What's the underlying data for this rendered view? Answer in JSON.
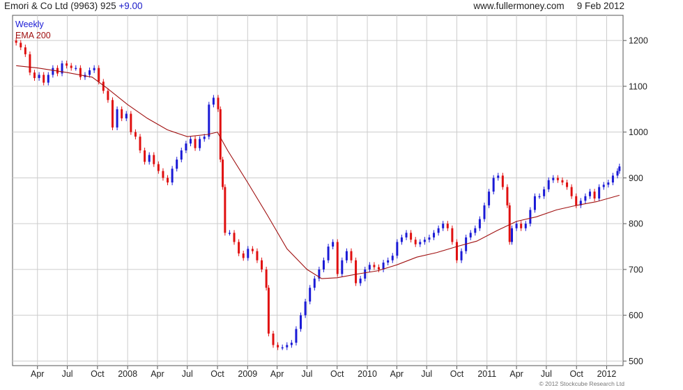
{
  "header": {
    "symbol": "Emori & Co Ltd (9963) 925",
    "change": "+9.00",
    "site": "www.fullermoney.com",
    "date": "9 Feb 2012"
  },
  "copyright": "© 2012 Stockcube Research Ltd",
  "colors": {
    "up_bar": "#1a1ad6",
    "down_bar": "#e01010",
    "ema_line": "#a01010",
    "grid": "#cccccc",
    "axis": "#555555"
  },
  "chart_data": {
    "type": "candlestick",
    "legend": [
      "Weekly",
      "EMA 200"
    ],
    "legend_colors": [
      "#1a1ad6",
      "#a01010"
    ],
    "ylim": [
      490,
      1255
    ],
    "y_ticks": [
      500,
      600,
      700,
      800,
      900,
      1000,
      1100,
      1200
    ],
    "x_ticks": [
      "Apr",
      "Jul",
      "Oct",
      "2008",
      "Apr",
      "Jul",
      "Oct",
      "2009",
      "Apr",
      "Jul",
      "Oct",
      "2010",
      "Apr",
      "Jul",
      "Oct",
      "2011",
      "Apr",
      "Jul",
      "Oct",
      "2012"
    ],
    "x_tick_dates": [
      "2007-04",
      "2007-07",
      "2007-10",
      "2008-01",
      "2008-04",
      "2008-07",
      "2008-10",
      "2009-01",
      "2009-04",
      "2009-07",
      "2009-10",
      "2010-01",
      "2010-04",
      "2010-07",
      "2010-10",
      "2011-01",
      "2011-04",
      "2011-07",
      "2011-10",
      "2012-01"
    ],
    "grid": true,
    "legend_position": "top-left",
    "close_series": [
      [
        "2007-01-26",
        1195
      ],
      [
        "2007-02-09",
        1185
      ],
      [
        "2007-02-23",
        1170
      ],
      [
        "2007-03-09",
        1130
      ],
      [
        "2007-03-23",
        1118
      ],
      [
        "2007-04-06",
        1125
      ],
      [
        "2007-04-20",
        1108
      ],
      [
        "2007-05-04",
        1125
      ],
      [
        "2007-05-18",
        1140
      ],
      [
        "2007-06-01",
        1128
      ],
      [
        "2007-06-15",
        1150
      ],
      [
        "2007-06-29",
        1145
      ],
      [
        "2007-07-13",
        1140
      ],
      [
        "2007-07-27",
        1140
      ],
      [
        "2007-08-10",
        1120
      ],
      [
        "2007-08-24",
        1125
      ],
      [
        "2007-09-07",
        1135
      ],
      [
        "2007-09-21",
        1140
      ],
      [
        "2007-10-05",
        1110
      ],
      [
        "2007-10-19",
        1090
      ],
      [
        "2007-11-02",
        1070
      ],
      [
        "2007-11-16",
        1010
      ],
      [
        "2007-11-30",
        1050
      ],
      [
        "2007-12-14",
        1030
      ],
      [
        "2007-12-28",
        1040
      ],
      [
        "2008-01-11",
        1000
      ],
      [
        "2008-01-25",
        990
      ],
      [
        "2008-02-08",
        960
      ],
      [
        "2008-02-22",
        935
      ],
      [
        "2008-03-07",
        950
      ],
      [
        "2008-03-21",
        930
      ],
      [
        "2008-04-04",
        915
      ],
      [
        "2008-04-18",
        900
      ],
      [
        "2008-05-02",
        890
      ],
      [
        "2008-05-16",
        920
      ],
      [
        "2008-05-30",
        940
      ],
      [
        "2008-06-13",
        960
      ],
      [
        "2008-06-27",
        975
      ],
      [
        "2008-07-11",
        985
      ],
      [
        "2008-07-25",
        965
      ],
      [
        "2008-08-08",
        985
      ],
      [
        "2008-08-22",
        990
      ],
      [
        "2008-09-05",
        1060
      ],
      [
        "2008-09-19",
        1075
      ],
      [
        "2008-10-03",
        1050
      ],
      [
        "2008-10-10",
        940
      ],
      [
        "2008-10-17",
        880
      ],
      [
        "2008-10-24",
        780
      ],
      [
        "2008-11-07",
        780
      ],
      [
        "2008-11-21",
        760
      ],
      [
        "2008-12-05",
        735
      ],
      [
        "2008-12-19",
        725
      ],
      [
        "2009-01-02",
        745
      ],
      [
        "2009-01-16",
        740
      ],
      [
        "2009-01-30",
        720
      ],
      [
        "2009-02-13",
        700
      ],
      [
        "2009-02-27",
        660
      ],
      [
        "2009-03-06",
        560
      ],
      [
        "2009-03-20",
        535
      ],
      [
        "2009-04-03",
        530
      ],
      [
        "2009-04-17",
        530
      ],
      [
        "2009-05-01",
        535
      ],
      [
        "2009-05-15",
        540
      ],
      [
        "2009-05-29",
        570
      ],
      [
        "2009-06-12",
        600
      ],
      [
        "2009-06-26",
        630
      ],
      [
        "2009-07-10",
        660
      ],
      [
        "2009-07-24",
        680
      ],
      [
        "2009-08-07",
        700
      ],
      [
        "2009-08-21",
        720
      ],
      [
        "2009-09-04",
        750
      ],
      [
        "2009-09-18",
        760
      ],
      [
        "2009-10-02",
        690
      ],
      [
        "2009-10-16",
        720
      ],
      [
        "2009-10-30",
        740
      ],
      [
        "2009-11-13",
        720
      ],
      [
        "2009-11-27",
        670
      ],
      [
        "2009-12-11",
        680
      ],
      [
        "2009-12-25",
        700
      ],
      [
        "2010-01-08",
        710
      ],
      [
        "2010-01-22",
        705
      ],
      [
        "2010-02-05",
        700
      ],
      [
        "2010-02-19",
        715
      ],
      [
        "2010-03-05",
        720
      ],
      [
        "2010-03-19",
        730
      ],
      [
        "2010-04-02",
        760
      ],
      [
        "2010-04-16",
        770
      ],
      [
        "2010-04-30",
        780
      ],
      [
        "2010-05-14",
        765
      ],
      [
        "2010-05-28",
        755
      ],
      [
        "2010-06-11",
        760
      ],
      [
        "2010-06-25",
        765
      ],
      [
        "2010-07-09",
        770
      ],
      [
        "2010-07-23",
        780
      ],
      [
        "2010-08-06",
        790
      ],
      [
        "2010-08-20",
        800
      ],
      [
        "2010-09-03",
        790
      ],
      [
        "2010-09-17",
        760
      ],
      [
        "2010-10-01",
        720
      ],
      [
        "2010-10-15",
        740
      ],
      [
        "2010-10-29",
        770
      ],
      [
        "2010-11-12",
        780
      ],
      [
        "2010-11-26",
        790
      ],
      [
        "2010-12-10",
        810
      ],
      [
        "2010-12-24",
        840
      ],
      [
        "2011-01-07",
        870
      ],
      [
        "2011-01-21",
        900
      ],
      [
        "2011-02-04",
        905
      ],
      [
        "2011-02-18",
        880
      ],
      [
        "2011-03-04",
        840
      ],
      [
        "2011-03-11",
        760
      ],
      [
        "2011-03-18",
        790
      ],
      [
        "2011-04-01",
        800
      ],
      [
        "2011-04-15",
        790
      ],
      [
        "2011-04-29",
        800
      ],
      [
        "2011-05-13",
        830
      ],
      [
        "2011-05-27",
        860
      ],
      [
        "2011-06-10",
        860
      ],
      [
        "2011-06-24",
        875
      ],
      [
        "2011-07-08",
        895
      ],
      [
        "2011-07-22",
        900
      ],
      [
        "2011-08-05",
        895
      ],
      [
        "2011-08-19",
        890
      ],
      [
        "2011-09-02",
        880
      ],
      [
        "2011-09-16",
        860
      ],
      [
        "2011-09-30",
        840
      ],
      [
        "2011-10-14",
        850
      ],
      [
        "2011-10-28",
        860
      ],
      [
        "2011-11-11",
        870
      ],
      [
        "2011-11-25",
        855
      ],
      [
        "2011-12-09",
        880
      ],
      [
        "2011-12-23",
        885
      ],
      [
        "2012-01-06",
        890
      ],
      [
        "2012-01-20",
        905
      ],
      [
        "2012-02-03",
        915
      ],
      [
        "2012-02-09",
        925
      ]
    ],
    "ema_200": [
      [
        "2007-01-26",
        1145
      ],
      [
        "2007-04-01",
        1140
      ],
      [
        "2007-07-01",
        1130
      ],
      [
        "2007-09-15",
        1120
      ],
      [
        "2007-11-01",
        1095
      ],
      [
        "2008-01-01",
        1060
      ],
      [
        "2008-03-01",
        1030
      ],
      [
        "2008-05-01",
        1005
      ],
      [
        "2008-07-01",
        990
      ],
      [
        "2008-09-01",
        995
      ],
      [
        "2008-10-01",
        1000
      ],
      [
        "2008-11-01",
        960
      ],
      [
        "2009-01-01",
        890
      ],
      [
        "2009-03-01",
        820
      ],
      [
        "2009-05-01",
        745
      ],
      [
        "2009-07-01",
        700
      ],
      [
        "2009-08-15",
        680
      ],
      [
        "2009-10-01",
        682
      ],
      [
        "2009-12-01",
        690
      ],
      [
        "2010-02-01",
        697
      ],
      [
        "2010-04-01",
        710
      ],
      [
        "2010-06-01",
        727
      ],
      [
        "2010-08-01",
        737
      ],
      [
        "2010-10-01",
        750
      ],
      [
        "2010-12-01",
        762
      ],
      [
        "2011-02-01",
        785
      ],
      [
        "2011-04-01",
        805
      ],
      [
        "2011-06-01",
        815
      ],
      [
        "2011-08-01",
        830
      ],
      [
        "2011-10-01",
        840
      ],
      [
        "2011-12-01",
        848
      ],
      [
        "2012-02-09",
        862
      ]
    ]
  }
}
